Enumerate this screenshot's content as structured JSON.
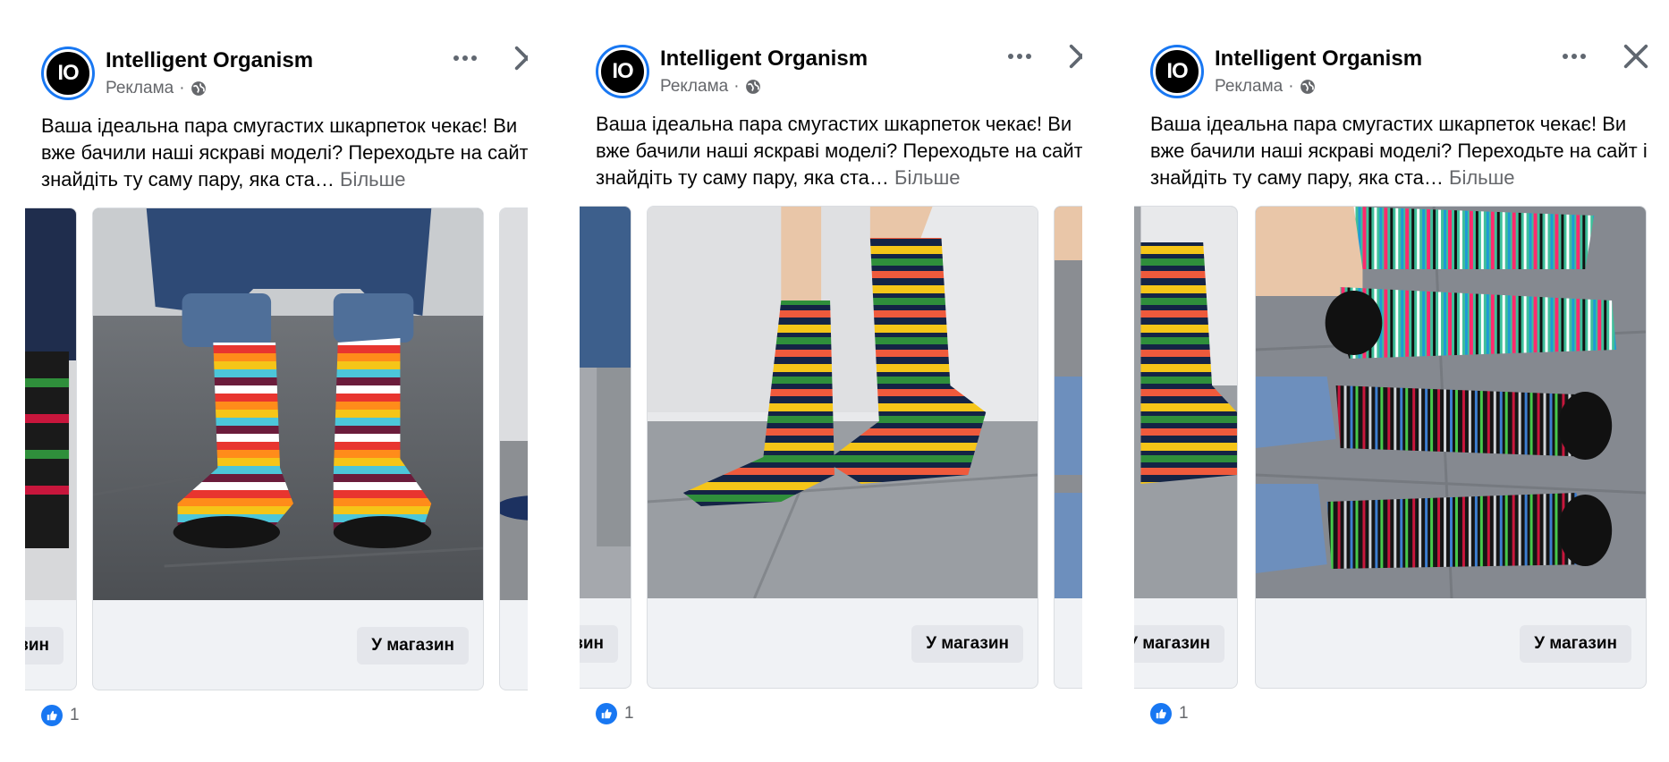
{
  "posts": [
    {
      "page_name": "Intelligent Organism",
      "avatar_text": "IO",
      "sponsored": "Реклама",
      "separator": "·",
      "text": "Ваша ідеальна пара смугастих шкарпеток чекає! Ви вже бачили наші яскраві моделі? Переходьте на сайт і знайдіть ту саму пару, яка ста…",
      "see_more": "Більше",
      "cards": [
        {
          "cta": "У магазин"
        },
        {
          "cta": "У магазин"
        }
      ],
      "reaction_count": "1"
    },
    {
      "page_name": "Intelligent Organism",
      "avatar_text": "IO",
      "sponsored": "Реклама",
      "separator": "·",
      "text": "Ваша ідеальна пара смугастих шкарпеток чекає! Ви вже бачили наші яскраві моделі? Переходьте на сайт і знайдіть ту саму пару, яка ста…",
      "see_more": "Більше",
      "cards": [
        {
          "cta": "У магазин"
        },
        {
          "cta": "У магазин"
        }
      ],
      "reaction_count": "1"
    },
    {
      "page_name": "Intelligent Organism",
      "avatar_text": "IO",
      "sponsored": "Реклама",
      "separator": "·",
      "text": "Ваша ідеальна пара смугастих шкарпеток чекає! Ви вже бачили наші яскраві моделі? Переходьте на сайт і знайдіть ту саму пару, яка ста…",
      "see_more": "Більше",
      "cards": [
        {
          "cta": "У магазин"
        },
        {
          "cta": "У магазин"
        }
      ],
      "reaction_count": "1"
    }
  ],
  "colors": {
    "accent": "#1877f2",
    "secondary_text": "#65676b",
    "button_bg": "#e4e6eb"
  },
  "icons": [
    "globe-icon",
    "more-options-icon",
    "close-icon",
    "like-icon"
  ]
}
